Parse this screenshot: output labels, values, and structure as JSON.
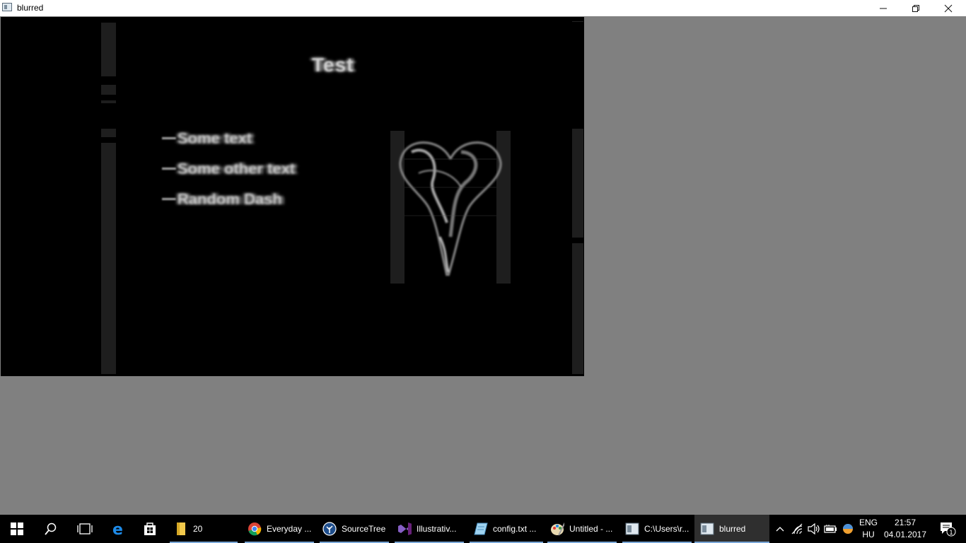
{
  "window": {
    "title": "blurred",
    "controls": [
      "minimize-icon",
      "restore-icon",
      "close-icon"
    ]
  },
  "game": {
    "heading": "Test",
    "menu_items": [
      {
        "label": "Some text"
      },
      {
        "label": "Some other text"
      },
      {
        "label": "Random Dash"
      }
    ],
    "image": "heart-icon"
  },
  "taskbar": {
    "start_icon": "windows-start-icon",
    "apps": [
      {
        "label": "20",
        "icon": "folder-icon"
      },
      {
        "label": "Everyday ...",
        "icon": "chrome-icon"
      },
      {
        "label": "SourceTree",
        "icon": "sourcetree-icon"
      },
      {
        "label": "Illustrativ...",
        "icon": "visual-studio-icon"
      },
      {
        "label": "config.txt ...",
        "icon": "notepad-icon"
      },
      {
        "label": "Untitled - ...",
        "icon": "paint-icon"
      },
      {
        "label": "C:\\Users\\r...",
        "icon": "console-icon"
      },
      {
        "label": "blurred",
        "icon": "app-window-icon"
      }
    ],
    "language": {
      "line1": "ENG",
      "line2": "HU"
    },
    "clock": {
      "time": "21:57",
      "date": "04.01.2017"
    },
    "notification_count": "1",
    "accent_color": "#7aa7d8"
  }
}
